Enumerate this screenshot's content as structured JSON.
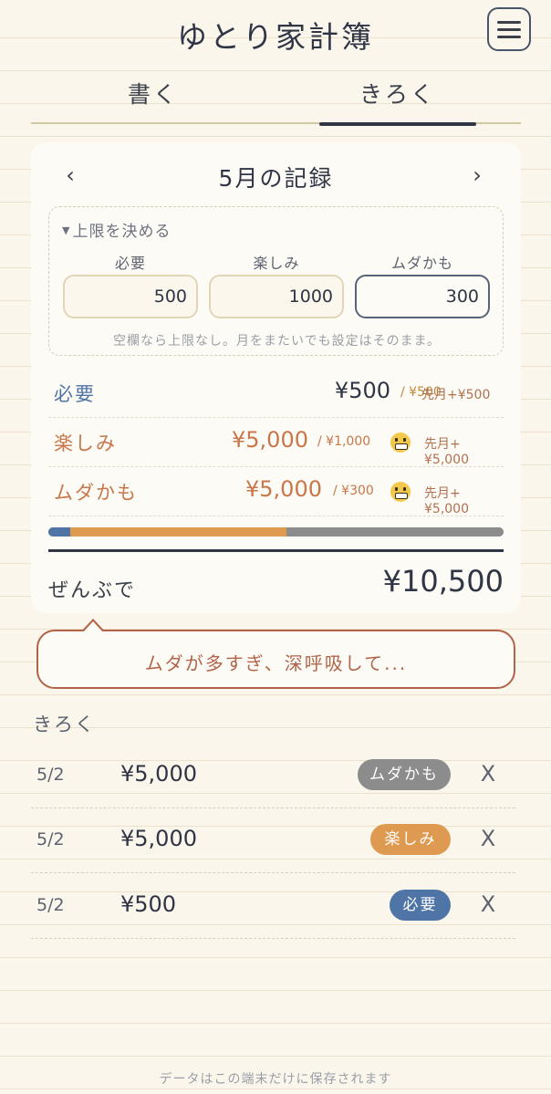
{
  "app": {
    "title": "ゆとり家計簿",
    "menu_icon": "hamburger-menu-icon"
  },
  "tabs": [
    {
      "label": "書く",
      "active": false
    },
    {
      "label": "きろく",
      "active": true
    }
  ],
  "summary": {
    "prev_arrow": "‹",
    "next_arrow": "›",
    "month_title": "5月の記録",
    "limits": {
      "toggle_label": "上限を決める",
      "toggle_icon": "triangle-down-icon",
      "need_label": "必要",
      "fun_label": "楽しみ",
      "waste_label": "ムダかも",
      "need_value": "500",
      "fun_value": "1000",
      "waste_value": "300",
      "hint": "空欄なら上限なし。月をまたいでも設定はそのまま。"
    },
    "categories": [
      {
        "name": "必要",
        "amount": "¥500",
        "limit": "/ ¥500",
        "prev": "先月+¥500",
        "over": false
      },
      {
        "name": "楽しみ",
        "amount": "¥5,000",
        "limit": "/ ¥1,000",
        "prev": "先月+¥5,000",
        "over": true,
        "face_icon": "grimacing-face-icon"
      },
      {
        "name": "ムダかも",
        "amount": "¥5,000",
        "limit": "/ ¥300",
        "prev": "先月+¥5,000",
        "over": true,
        "face_icon": "grimacing-face-icon"
      }
    ],
    "breakdown": [
      {
        "category": "必要",
        "value": 500,
        "color": "#4f74a6"
      },
      {
        "category": "楽しみ",
        "value": 5000,
        "color": "#df9a52"
      },
      {
        "category": "ムダかも",
        "value": 5000,
        "color": "#8c8c8c"
      }
    ],
    "total_label": "ぜんぶで",
    "total_value": "¥10,500"
  },
  "message": "ムダが多すぎ、深呼吸して...",
  "records_title": "きろく",
  "records": [
    {
      "date": "5/2",
      "amount": "¥5,000",
      "tag": "ムダかも",
      "tag_color": "#8c8c8c",
      "delete": "X"
    },
    {
      "date": "5/2",
      "amount": "¥5,000",
      "tag": "楽しみ",
      "tag_color": "#df9a52",
      "delete": "X"
    },
    {
      "date": "5/2",
      "amount": "¥500",
      "tag": "必要",
      "tag_color": "#4f74a6",
      "delete": "X"
    }
  ],
  "footer_note": "データはこの端末だけに保存されます",
  "colors": {
    "background": "#faf6ec",
    "ink": "#2f3545",
    "need": "#4f74a6",
    "fun": "#df9a52",
    "waste": "#8c8c8c",
    "warning": "#b0644a"
  }
}
